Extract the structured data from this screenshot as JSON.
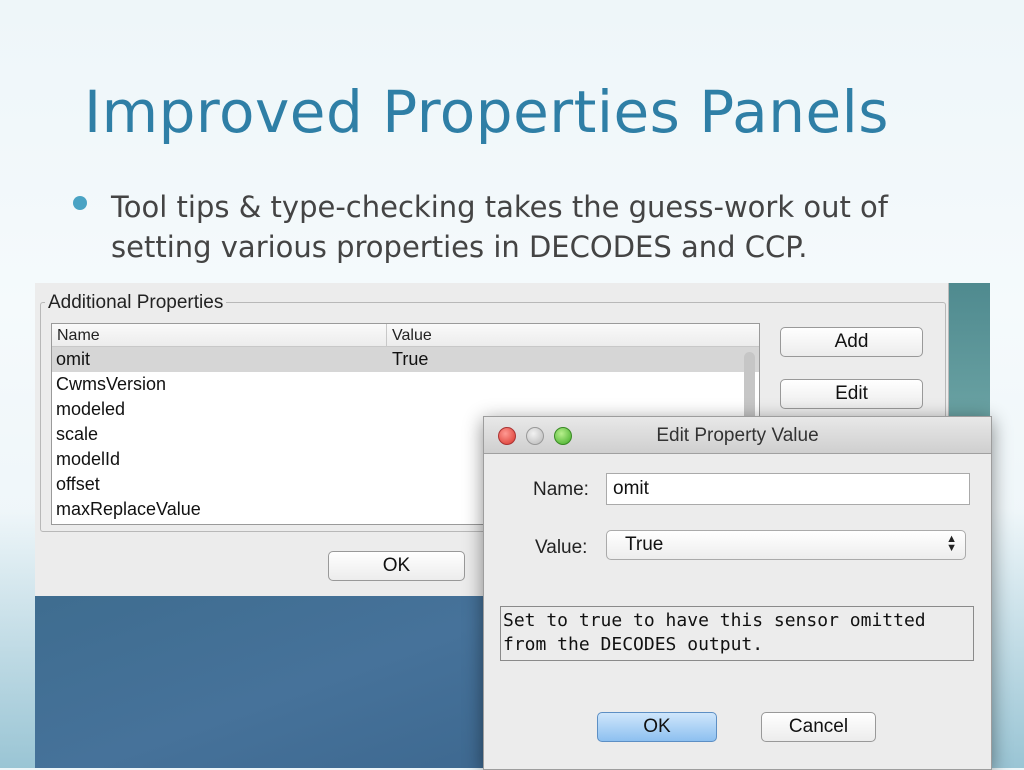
{
  "slide": {
    "title": "Improved Properties Panels",
    "bullet": "Tool tips & type-checking takes the guess-work out of  setting various properties in DECODES and CCP."
  },
  "main_panel": {
    "group_label": "Additional Properties",
    "table": {
      "headers": [
        "Name",
        "Value"
      ],
      "rows": [
        {
          "name": "omit",
          "value": "True",
          "selected": true
        },
        {
          "name": "CwmsVersion",
          "value": ""
        },
        {
          "name": "modeled",
          "value": ""
        },
        {
          "name": "scale",
          "value": ""
        },
        {
          "name": "modelId",
          "value": ""
        },
        {
          "name": "offset",
          "value": ""
        },
        {
          "name": "maxReplaceValue",
          "value": ""
        }
      ]
    },
    "buttons": {
      "add": "Add",
      "edit": "Edit",
      "ok": "OK"
    }
  },
  "dialog": {
    "title": "Edit Property Value",
    "name_label": "Name:",
    "name_value": "omit",
    "value_label": "Value:",
    "value_selected": "True",
    "tooltip": "Set to true to have this sensor omitted from the DECODES output.",
    "ok_label": "OK",
    "cancel_label": "Cancel"
  },
  "icons": {
    "bullet": "bullet-dot-icon",
    "close": "close-window-icon",
    "minimize": "minimize-window-icon",
    "maximize": "zoom-window-icon",
    "select_arrows": "up-down-arrows-icon"
  },
  "colors": {
    "title": "#2f7fa6",
    "bullet": "#4aa3c4",
    "default_button": "#8dc0f0"
  }
}
